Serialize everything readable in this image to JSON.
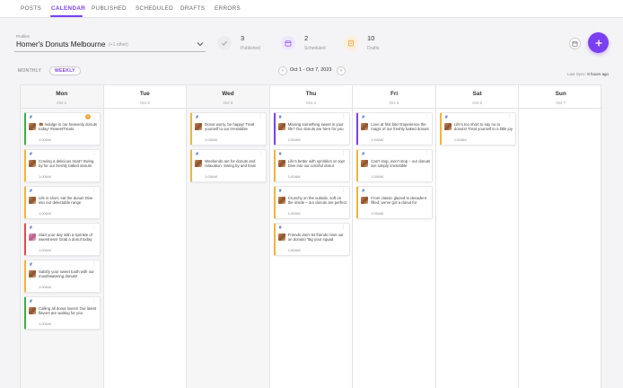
{
  "nav": {
    "tabs": [
      "POSTS",
      "CALENDAR",
      "PUBLISHED",
      "SCHEDULED",
      "DRAFTS",
      "ERRORS"
    ],
    "active": "CALENDAR",
    "accent": "#7b3ff2"
  },
  "profiles": {
    "label": "Profiles",
    "name": "Homer's Donuts Melbourne",
    "extra": "(+1 other)"
  },
  "stats": [
    {
      "value": "3",
      "label": "Published",
      "icon": "check-icon",
      "color": "#9aa0a6"
    },
    {
      "value": "2",
      "label": "Scheduled",
      "icon": "calendar-icon",
      "color": "#8b5cf6"
    },
    {
      "value": "10",
      "label": "Drafts",
      "icon": "draft-icon",
      "color": "#e3a44a"
    }
  ],
  "views": {
    "monthly": "MONTHLY",
    "weekly": "WEEKLY",
    "active": "WEEKLY"
  },
  "range": "Oct 1 - Oct 7, 2023",
  "last_sync": {
    "label": "Last Sync:",
    "value": "8 hours ago"
  },
  "days": [
    {
      "name": "Mon",
      "date": "Oct 1",
      "shaded": true,
      "posts": [
        {
          "color": "green",
          "text": "🍩 Indulge in our heavenly donuts today! #SweetTreats",
          "time": "1:00AM",
          "warn": true,
          "thumb": "brown"
        },
        {
          "color": "yellow",
          "text": "Craving a delicious treat? Swing by for our freshly baked donuts",
          "time": "1:00AM",
          "thumb": "brown"
        },
        {
          "color": "yellow",
          "text": "Life is short, eat the donut! Dive into our delectable range",
          "time": "1:00AM",
          "thumb": "brown"
        },
        {
          "color": "red",
          "text": "Start your day with a sprinkle of sweetness! Grab a donut today",
          "time": "1:00AM",
          "thumb": "pink"
        },
        {
          "color": "yellow",
          "text": "Satisfy your sweet tooth with our mouthwatering donuts!",
          "time": "1:00AM",
          "thumb": "brown"
        },
        {
          "color": "green",
          "text": "Calling all donut lovers! Our latest flavors are waiting for you",
          "time": "1:00AM",
          "thumb": "brown"
        }
      ]
    },
    {
      "name": "Tue",
      "date": "Oct 2",
      "shaded": false,
      "posts": []
    },
    {
      "name": "Wed",
      "date": "Oct 3",
      "shaded": true,
      "posts": [
        {
          "color": "yellow",
          "text": "Donut worry, be happy! Treat yourself to our irresistible creations",
          "time": "1:00AM",
          "thumb": "brown"
        },
        {
          "color": "yellow",
          "text": "Weekends are for donuts and relaxation. Swing by and treat yourself",
          "time": "1:00AM",
          "thumb": "brown"
        }
      ]
    },
    {
      "name": "Thu",
      "date": "Oct 4",
      "shaded": false,
      "posts": [
        {
          "color": "purple",
          "text": "Missing something sweet in your life? Our donuts are here for you",
          "time": "1:00AM",
          "thumb": "brown"
        },
        {
          "color": "yellow",
          "text": "Life's better with sprinkles on top! Dive into our colorful donut delights",
          "time": "1:00AM",
          "thumb": "brown"
        },
        {
          "color": "yellow",
          "text": "Crunchy on the outside, soft on the inside – our donuts are perfect",
          "time": "1:00AM",
          "thumb": "brown"
        },
        {
          "color": "yellow",
          "text": "Friends don't let friends miss out on donuts! Tag your squad",
          "time": "1:00AM",
          "thumb": "brown"
        }
      ]
    },
    {
      "name": "Fri",
      "date": "Oct 5",
      "shaded": false,
      "posts": [
        {
          "color": "purple",
          "text": "Love at first bite! Experience the magic of our freshly baked donuts",
          "time": "1:00AM",
          "thumb": "brown"
        },
        {
          "color": "yellow",
          "text": "Can't stop, won't stop – our donuts are simply irresistible",
          "time": "1:00AM",
          "thumb": "brown"
        },
        {
          "color": "yellow",
          "text": "From classic glazed to decadent filled, we've got a donut for everyone",
          "time": "1:00AM",
          "thumb": "brown"
        }
      ]
    },
    {
      "name": "Sat",
      "date": "Oct 6",
      "shaded": false,
      "posts": [
        {
          "color": "yellow",
          "text": "Life's too short to say no to donuts! Treat yourself to a little joy",
          "time": "1:00AM",
          "thumb": "brown"
        }
      ]
    },
    {
      "name": "Sun",
      "date": "Oct 7",
      "shaded": false,
      "posts": []
    }
  ]
}
